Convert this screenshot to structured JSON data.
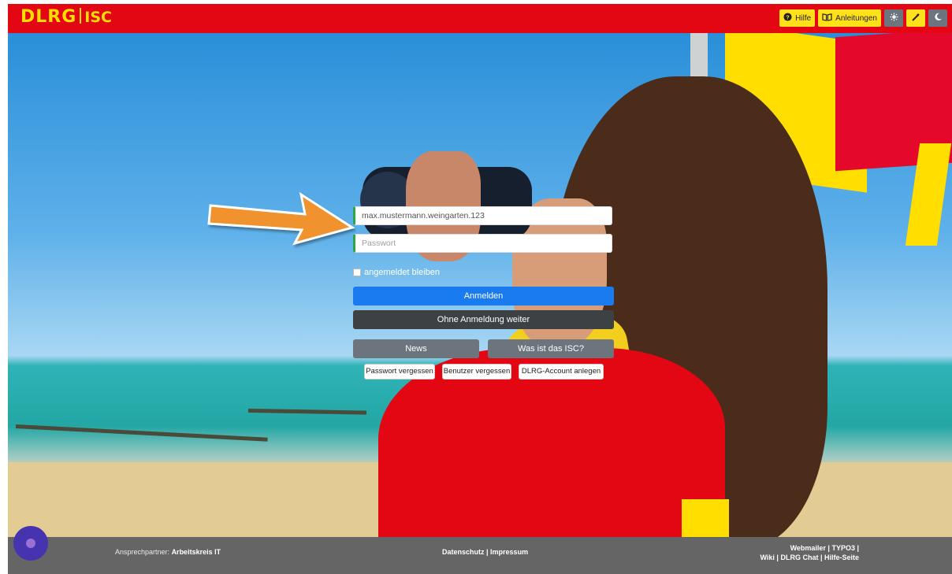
{
  "header": {
    "logo_text": "DLRG",
    "logo_sub": "ISC",
    "help_label": "Hilfe",
    "guides_label": "Anleitungen",
    "theme_icons": [
      "sun-icon",
      "magic-wand-icon",
      "moon-icon"
    ]
  },
  "login": {
    "username_value": "max.mustermann.weingarten.123",
    "password_placeholder": "Passwort",
    "remember_label": "angemeldet bleiben",
    "login_button": "Anmelden",
    "guest_button": "Ohne Anmeldung weiter",
    "news_button": "News",
    "about_button": "Was ist das ISC?",
    "forgot_password": "Passwort vergessen",
    "forgot_user": "Benutzer vergessen",
    "create_account": "DLRG-Account anlegen"
  },
  "footer": {
    "contact_prefix": "Ansprechpartner:",
    "contact_name": "Arbeitskreis IT",
    "privacy": "Datenschutz",
    "imprint": "Impressum",
    "webmailer": "Webmailer",
    "typo3": "TYPO3",
    "wiki": "Wiki",
    "chat": "DLRG Chat",
    "help_page": "Hilfe-Seite"
  },
  "colors": {
    "brand_red": "#e30613",
    "brand_yellow": "#ffde00",
    "primary_button": "#1a7bf0",
    "arrow": "#f0922f"
  }
}
